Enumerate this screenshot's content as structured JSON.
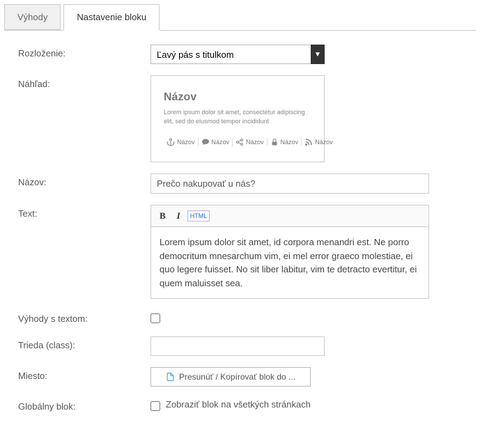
{
  "tabs": {
    "benefits": "Výhody",
    "block_settings": "Nastavenie bloku"
  },
  "labels": {
    "layout": "Rozloženie:",
    "preview": "Náhľad:",
    "title": "Názov:",
    "text": "Text:",
    "benefits_text": "Výhody s textom:",
    "class": "Trieda (class):",
    "place": "Miesto:",
    "global_block": "Globálny blok:"
  },
  "layout_select": {
    "value": "Ľavý pás s titulkom"
  },
  "preview": {
    "title": "Názov",
    "lorem": "Lorem ipsum dolor sit amet, consectetur adipiscing elit, sed do eiusmod tempor incididunt",
    "item_label": "Názov"
  },
  "title_input": "Prečo nakupovať u nás?",
  "editor": {
    "bold": "B",
    "italic": "I",
    "html": "HTML",
    "content": "Lorem ipsum dolor sit amet, id corpora menandri est. Ne porro democritum mnesarchum vim, ei mel error graeco molestiae, ei quo legere fuisset. No sit liber labitur, vim te detracto evertitur, ei quem maluisset sea."
  },
  "move_button": "Presunúť / Kopírovať blok do ...",
  "global_checkbox_label": "Zobraziť blok na všetkých stránkach"
}
